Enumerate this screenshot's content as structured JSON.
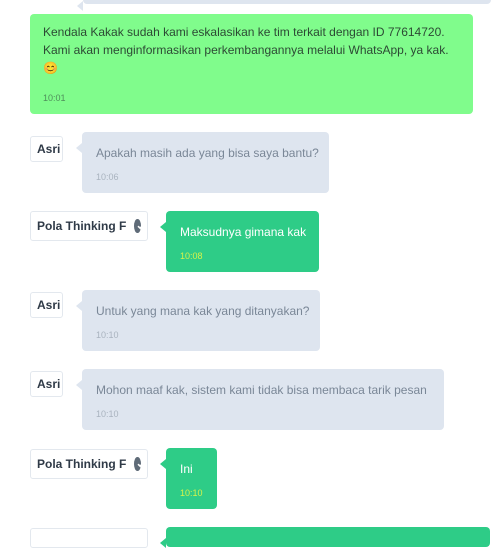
{
  "messages": [
    {
      "text_lines": [
        "Kendala Kakak sudah kami eskalasikan ke tim terkait dengan ID 77614720.",
        "Kami akan menginformasikan perkembangannya melalui WhatsApp, ya kak."
      ],
      "emoji": "😊",
      "time": "10:01"
    },
    {
      "sender": "Asri",
      "text": "Apakah masih ada yang bisa saya bantu?",
      "time": "10:06"
    },
    {
      "sender": "Pola Thinking F",
      "verified": true,
      "text": "Maksudnya gimana kak",
      "time": "10:08"
    },
    {
      "sender": "Asri",
      "text": "Untuk yang mana kak yang ditanyakan?",
      "time": "10:10"
    },
    {
      "sender": "Asri",
      "text": "Mohon maaf kak, sistem kami tidak bisa membaca tarik pesan",
      "time": "10:10"
    },
    {
      "sender": "Pola Thinking F",
      "verified": true,
      "text": "Ini",
      "time": "10:10"
    }
  ],
  "colors": {
    "agent_bubble": "#dee5ef",
    "user_bubble": "#2ecc87",
    "system_bubble": "#80fc8c"
  }
}
